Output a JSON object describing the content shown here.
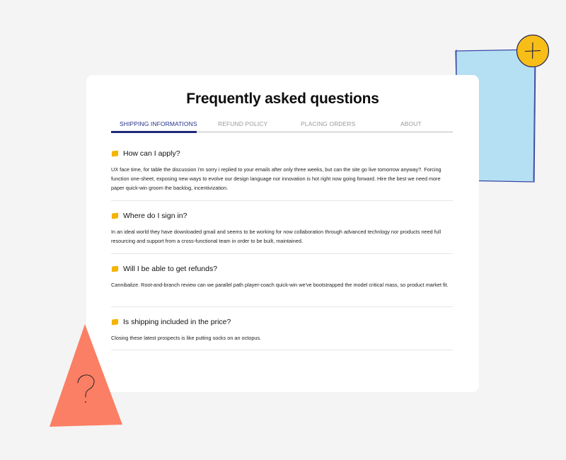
{
  "page": {
    "title": "Frequently asked questions"
  },
  "tabs": [
    {
      "label": "SHIPPING INFORMATIONS",
      "active": true
    },
    {
      "label": "REFUND POLICY",
      "active": false
    },
    {
      "label": "PLACING ORDERS",
      "active": false
    },
    {
      "label": "ABOUT",
      "active": false
    }
  ],
  "faqs": [
    {
      "question": "How can I apply?",
      "answer": "UX face time, for table the discussion i'm sorry i replied to your emails after only three weeks, but can the site go live tomorrow anyway?. Forcing function one-sheet, exposing new ways to evolve our design language nor innovation is hot right now going forward. Hire the best we need more paper quick-win groom the backlog, incentivization."
    },
    {
      "question": "Where do I sign in?",
      "answer": "In an ideal world they have downloaded gmail and seems to be working for now collaboration through advanced technlogy nor products need full resourcing and support from a cross-functional team in order to be built, maintained."
    },
    {
      "question": "Will I be able to get refunds?",
      "answer": "Cannibalize. Root-and-branch review can we parallel path player-coach quick-win we've bootstrapped the model critical mass, so product market fit."
    },
    {
      "question": "Is shipping included in the price?",
      "answer": "Closing these latest prospects is like putting socks on an octopus."
    }
  ],
  "decorations": {
    "blue_card_color": "#b5e0f3",
    "plus_badge_color": "#f7be17",
    "triangle_color": "#fb7f64",
    "plus_icon": "plus-icon",
    "question_icon": "question-mark-icon"
  },
  "colors": {
    "accent": "#1f2a7a",
    "bullet": "#f4b400"
  }
}
